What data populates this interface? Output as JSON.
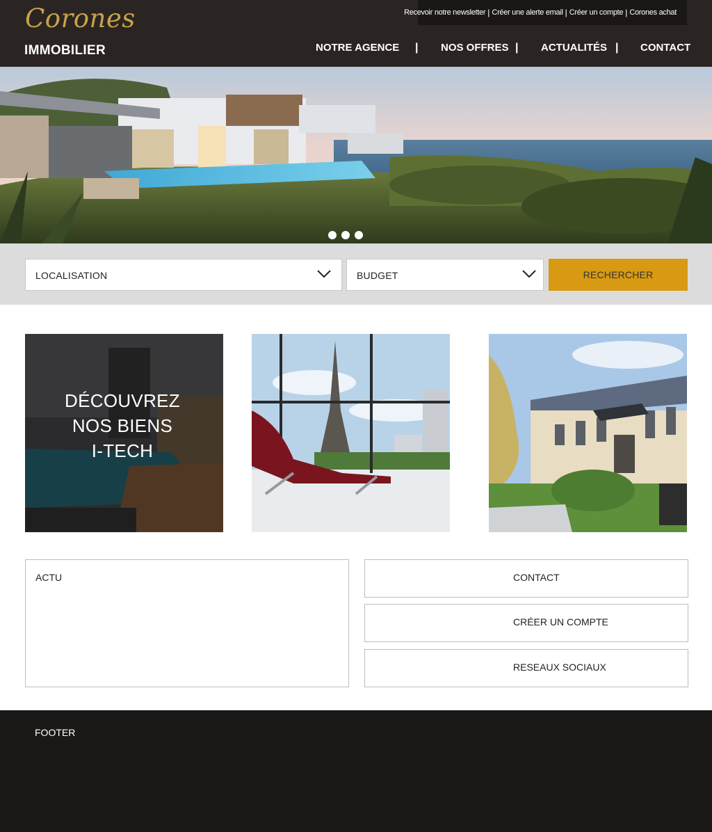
{
  "brand": {
    "script": "Corones",
    "sub": "IMMOBILIER"
  },
  "toplinks": [
    "Recevoir notre newsletter",
    "Créer une alerte email",
    "Créer un compte",
    "Corones achat"
  ],
  "nav": [
    "NOTRE AGENCE",
    "NOS OFFRES",
    "ACTUALITÉS",
    "CONTACT"
  ],
  "search": {
    "location_label": "LOCALISATION",
    "budget_label": "BUDGET",
    "submit_label": "RECHERCHER"
  },
  "tiles": {
    "itech_line1": "DÉCOUVREZ",
    "itech_line2": "NOS BIENS",
    "itech_line3": "I-TECH"
  },
  "actu_title": "ACTU",
  "sidebar": {
    "contact": "CONTACT",
    "create_account": "CRÉER UN COMPTE",
    "social": "RESEAUX SOCIAUX"
  },
  "footer_title": "FOOTER",
  "colors": {
    "header_bg": "#2a2523",
    "accent": "#d89a12",
    "logo_gold": "#c9a24a",
    "footer_bg": "#1b1918",
    "search_bg": "#dcdcdc"
  }
}
